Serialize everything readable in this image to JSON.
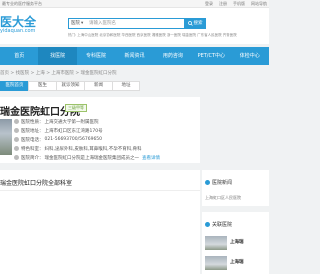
{
  "topbar": {
    "left": "最专业的医疗服务平台",
    "links": [
      "登录",
      "注册",
      "手机版",
      "网站导航"
    ]
  },
  "logo": {
    "title": "医大全",
    "url_text": "yidaquan.com"
  },
  "search": {
    "category": "医院",
    "placeholder": "请输入医院名",
    "button": "搜索",
    "hot": "热门: 上海中山医院 北京协和医院 华西医院 西京医院 湘雅医院 浙一医院 瑞金医院 广东省人民医院 齐鲁医院"
  },
  "nav": {
    "items": [
      "首页",
      "找医院",
      "专科医院",
      "新闻资讯",
      "用药咨询",
      "PET/CT中心",
      "体检中心"
    ],
    "active": 1
  },
  "breadcrumb": "首页 > 找医院 > 上海 > 上海市医院 > 瑞金医院虹口分院",
  "tabs": {
    "items": [
      "医院首页",
      "医生",
      "就诊须知",
      "新闻",
      "地址"
    ],
    "active": 0
  },
  "hospital": {
    "name": "瑞金医院虹口分院",
    "badge": "三级甲等",
    "rows": [
      {
        "label": "医院性质：",
        "value": "上海交通大学第一附属医院"
      },
      {
        "label": "医院地址：",
        "value": "上海市虹口区东江湾路170号"
      },
      {
        "label": "医院电话：",
        "value": "021-56693700/56769650"
      },
      {
        "label": "特色科室：",
        "value": "妇科,泌尿外科,皮肤科,耳鼻喉科,不孕不育科,骨科"
      },
      {
        "label": "医院简介：",
        "value": "瑞金医院虹口分院是上海瑞金医院集团成员之一",
        "more": "查看详情"
      }
    ]
  },
  "section": {
    "title": "瑞金医院虹口分院全部科室"
  },
  "side": {
    "news_title": "医院新闻",
    "news_text": "上海虹口区人民医院",
    "related_title": "关联医院",
    "cards": [
      "上海瑞",
      "上海瑞"
    ]
  }
}
